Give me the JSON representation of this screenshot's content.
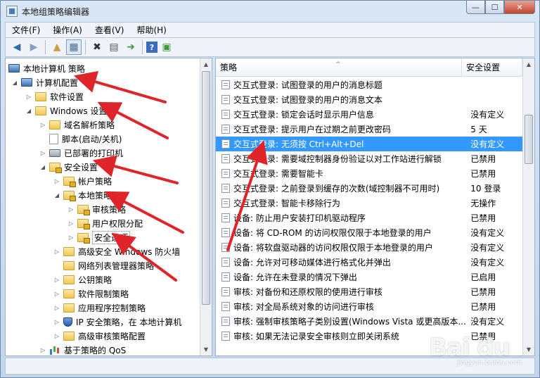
{
  "window": {
    "title": "本地组策略编辑器"
  },
  "menu": [
    "文件(F)",
    "操作(A)",
    "查看(V)",
    "帮助(H)"
  ],
  "tree": {
    "root": "本地计算机 策略",
    "nodes": [
      "计算机配置",
      "软件设置",
      "Windows 设置",
      "域名解析策略",
      "脚本(启动/关机)",
      "已部署的打印机",
      "安全设置",
      "帐户策略",
      "本地策略",
      "审核策略",
      "用户权限分配",
      "安全选项",
      "高级安全 Windows 防火墙",
      "网络列表管理器策略",
      "公钥策略",
      "软件限制策略",
      "应用程序控制策略",
      "IP 安全策略，在 本地计算机",
      "高级审核策略配置",
      "基于策略的 QoS"
    ]
  },
  "list": {
    "columns": [
      "策略",
      "安全设置"
    ],
    "rows": [
      {
        "name": "交互式登录: 试图登录的用户的消息标题",
        "value": ""
      },
      {
        "name": "交互式登录: 试图登录的用户的消息文本",
        "value": ""
      },
      {
        "name": "交互式登录: 锁定会话时显示用户信息",
        "value": "没有定义"
      },
      {
        "name": "交互式登录: 提示用户在过期之前更改密码",
        "value": "5 天"
      },
      {
        "name": "交互式登录: 无须按 Ctrl+Alt+Del",
        "value": "没有定义"
      },
      {
        "name": "交互式登录: 需要域控制器身份验证以对工作站进行解锁",
        "value": "已禁用"
      },
      {
        "name": "交互式登录: 需要智能卡",
        "value": "已禁用"
      },
      {
        "name": "交互式登录: 之前登录到缓存的次数(域控制器不可用时)",
        "value": "10 登录"
      },
      {
        "name": "交互式登录: 智能卡移除行为",
        "value": "无操作"
      },
      {
        "name": "设备: 防止用户安装打印机驱动程序",
        "value": "已禁用"
      },
      {
        "name": "设备: 将 CD-ROM 的访问权限仅限于本地登录的用户",
        "value": "没有定义"
      },
      {
        "name": "设备: 将软盘驱动器的访问权限仅限于本地登录的用户",
        "value": "没有定义"
      },
      {
        "name": "设备: 允许对可移动媒体进行格式化并弹出",
        "value": "没有定义"
      },
      {
        "name": "设备: 允许在未登录的情况下弹出",
        "value": "已启用"
      },
      {
        "name": "审核: 对备份和还原权限的使用进行审核",
        "value": "已禁用"
      },
      {
        "name": "审核: 对全局系统对象的访问进行审核",
        "value": "已禁用"
      },
      {
        "name": "审核: 强制审核策略子类别设置(Windows Vista 或更高版本...",
        "value": "没有定义"
      },
      {
        "name": "审核: 如果无法记录安全审核则立即关闭系统",
        "value": "已禁用"
      }
    ],
    "selected_index": 4
  },
  "watermark": {
    "logo": "Bai du",
    "sub": "jingyan.baidu.com"
  },
  "colors": {
    "selection": "#3399ff",
    "annotation_arrow": "#e0252a"
  }
}
